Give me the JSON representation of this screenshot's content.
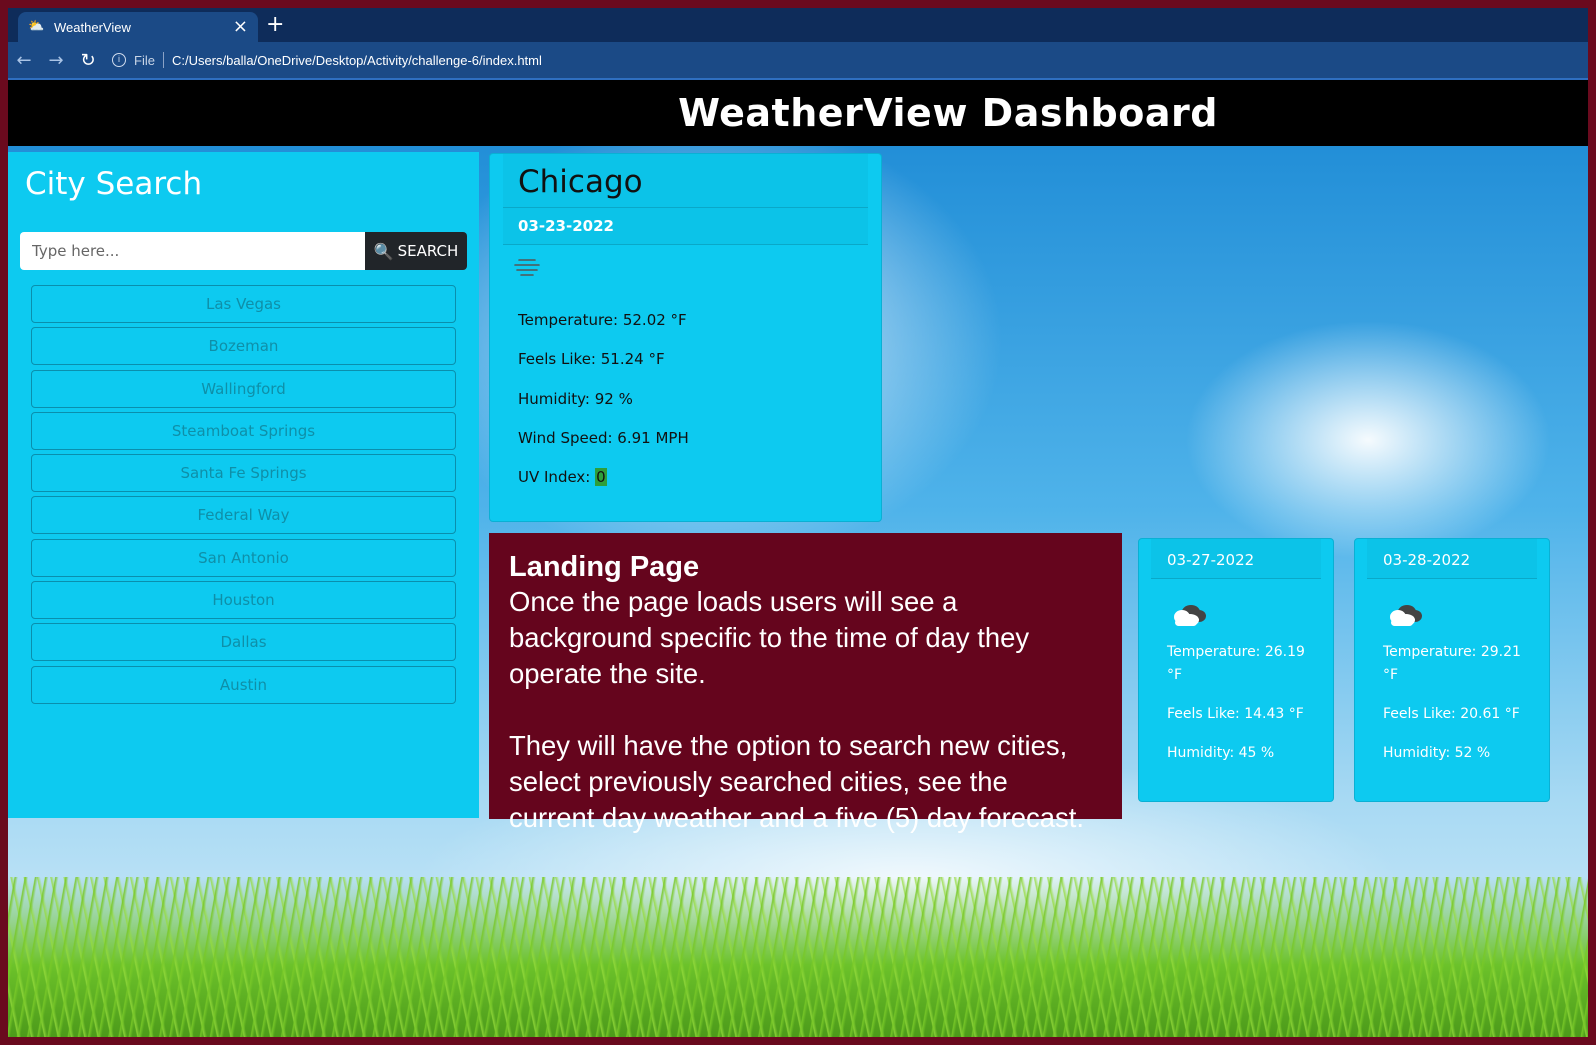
{
  "browser": {
    "tab_title": "WeatherView",
    "new_tab": "+",
    "url_scheme": "File",
    "url": "C:/Users/balla/OneDrive/Desktop/Activity/challenge-6/index.html"
  },
  "header": {
    "title": "WeatherView Dashboard"
  },
  "sidebar": {
    "title": "City Search",
    "search_placeholder": "Type here...",
    "search_button": "SEARCH",
    "cities": [
      "Las Vegas",
      "Bozeman",
      "Wallingford",
      "Steamboat Springs",
      "Santa Fe Springs",
      "Federal Way",
      "San Antonio",
      "Houston",
      "Dallas",
      "Austin"
    ]
  },
  "current": {
    "city": "Chicago",
    "date": "03-23-2022",
    "icon": "fog-icon",
    "temperature": "Temperature: 52.02 °F",
    "feels_like": "Feels Like: 51.24 °F",
    "humidity": "Humidity: 92 %",
    "wind": "Wind Speed: 6.91 MPH",
    "uv_label": "UV Index: ",
    "uv_value": "0"
  },
  "note": {
    "title": "Landing Page",
    "line1": "Once the page loads users will see a background specific to the time of day they operate the site.",
    "line2": "They will have the option to search new cities, select previously searched cities, see the current day weather and a five (5) day forecast."
  },
  "forecast": [
    {
      "date": "03-27-2022",
      "icon": "cloud-icon",
      "temperature": "Temperature: 26.19 °F",
      "feels_like": "Feels Like: 14.43 °F",
      "humidity": "Humidity: 45 %"
    },
    {
      "date": "03-28-2022",
      "icon": "cloud-icon",
      "temperature": "Temperature: 29.21 °F",
      "feels_like": "Feels Like: 20.61 °F",
      "humidity": "Humidity: 52 %"
    }
  ],
  "colors": {
    "card": "#0dcaf0",
    "note": "#65051d",
    "header": "#000000",
    "uv_badge": "#2e9e3a"
  }
}
